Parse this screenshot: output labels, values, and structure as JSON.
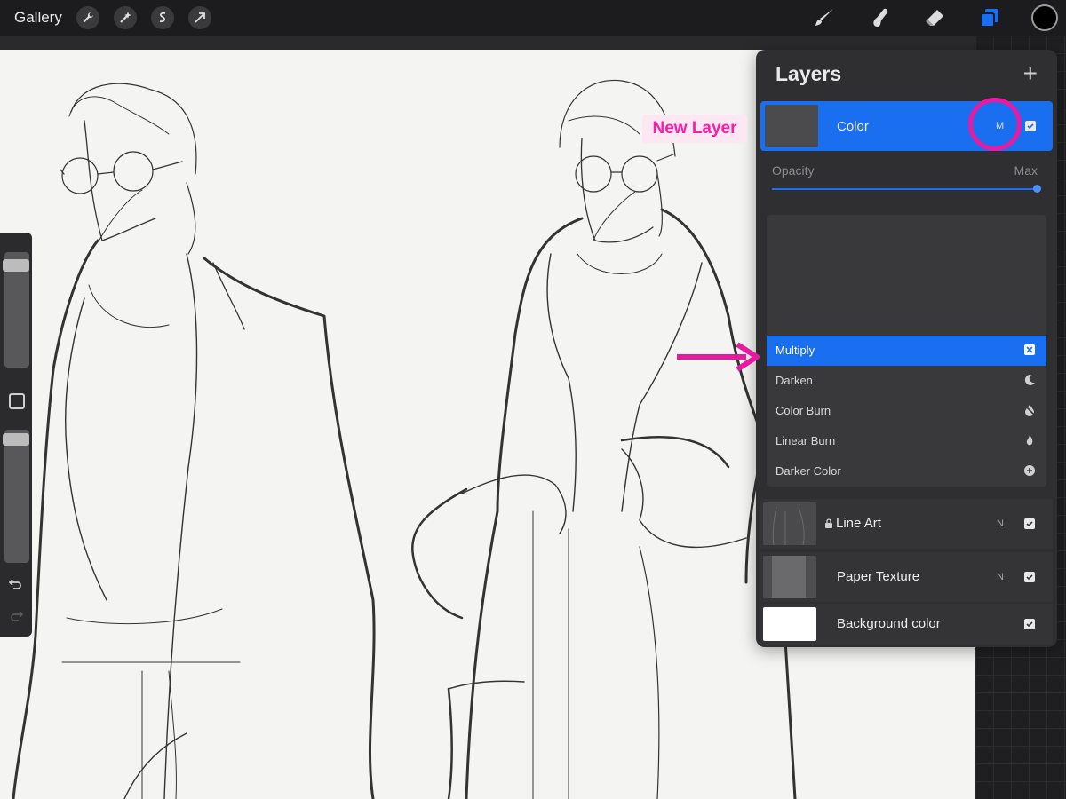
{
  "topbar": {
    "gallery_label": "Gallery",
    "left_tools": [
      "wrench-icon",
      "magic-wand-icon",
      "selection-s-icon",
      "transform-arrow-icon"
    ],
    "right_tools": [
      "brush-icon",
      "smudge-icon",
      "eraser-icon",
      "layers-icon"
    ],
    "current_color": "#000000"
  },
  "layers_panel": {
    "title": "Layers",
    "add_label": "+",
    "active_layer": {
      "name": "Color",
      "blend_code": "M",
      "visible": true
    },
    "opacity": {
      "label": "Opacity",
      "max_label": "Max",
      "value": 1.0
    },
    "blend_modes": [
      {
        "label": "Multiply",
        "icon": "multiply-icon",
        "selected": true
      },
      {
        "label": "Darken",
        "icon": "moon-icon",
        "selected": false
      },
      {
        "label": "Color Burn",
        "icon": "color-burn-icon",
        "selected": false
      },
      {
        "label": "Linear Burn",
        "icon": "flame-icon",
        "selected": false
      },
      {
        "label": "Darker Color",
        "icon": "plus-circle-icon",
        "selected": false
      }
    ],
    "layers": [
      {
        "name": "Line Art",
        "blend_code": "N",
        "locked": true,
        "visible": true
      },
      {
        "name": "Paper Texture",
        "blend_code": "N",
        "locked": false,
        "visible": true
      },
      {
        "name": "Background color",
        "blend_code": "",
        "locked": false,
        "visible": true
      }
    ]
  },
  "annotations": {
    "new_layer_label": "New Layer",
    "accent_color": "#e81aa0"
  },
  "colors": {
    "accent_blue": "#1a6ff0",
    "panel_bg": "#2f2f31",
    "topbar_bg": "#1c1c1e"
  }
}
